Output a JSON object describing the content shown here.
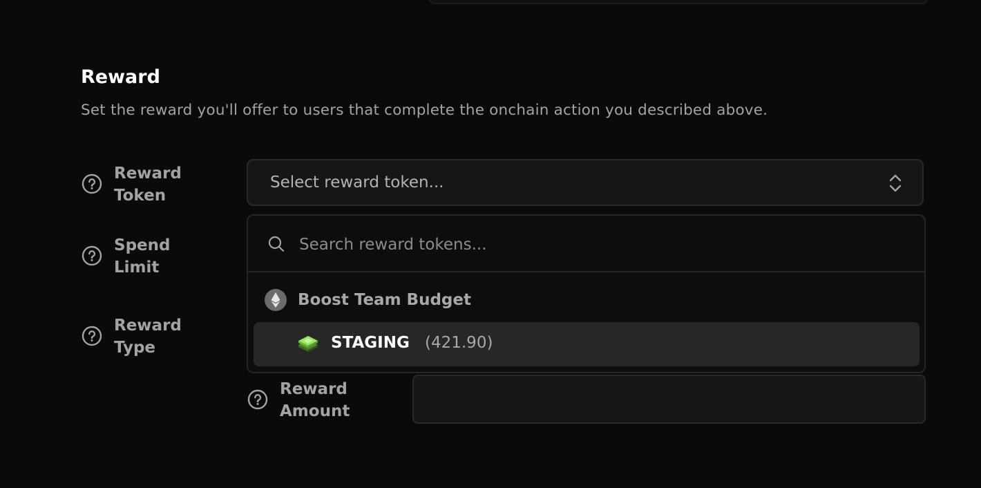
{
  "section": {
    "title": "Reward",
    "description": "Set the reward you'll offer to users that complete the onchain action you described above."
  },
  "fields": {
    "reward_token_label_1": "Reward",
    "reward_token_label_2": "Token",
    "spend_limit_label_1": "Spend",
    "spend_limit_label_2": "Limit",
    "reward_type_label_1": "Reward",
    "reward_type_label_2": "Type",
    "reward_amount_label_1": "Reward",
    "reward_amount_label_2": "Amount"
  },
  "select": {
    "placeholder": "Select reward token..."
  },
  "dropdown": {
    "search_placeholder": "Search reward tokens...",
    "group_label": "Boost Team Budget",
    "option": {
      "name": "STAGING",
      "balance": "(421.90)"
    }
  },
  "reward_amount": {
    "value": ""
  },
  "icons": {
    "help": "question-circle-icon",
    "chevron": "chevron-up-down-icon",
    "search": "search-icon",
    "group": "ethereum-icon",
    "token": "token-stack-icon"
  },
  "colors": {
    "background": "#0a0a0a",
    "accent_green": "#9be564"
  }
}
